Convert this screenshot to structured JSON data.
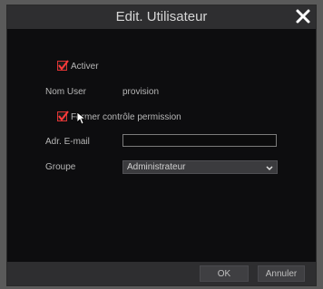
{
  "dialog": {
    "title": "Edit. Utilisateur"
  },
  "form": {
    "enable_label": "Activer",
    "enable_checked": true,
    "username_label": "Nom User",
    "username_value": "provision",
    "permission_label": "Fermer contrôle permission",
    "permission_checked": true,
    "email_label": "Adr. E-mail",
    "email_value": "",
    "group_label": "Groupe",
    "group_value": "Administrateur"
  },
  "footer": {
    "ok_label": "OK",
    "cancel_label": "Annuler"
  },
  "colors": {
    "accent_red": "#d33333",
    "panel": "#0d0d0f",
    "titlebar": "#2e2e30"
  }
}
